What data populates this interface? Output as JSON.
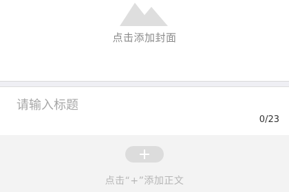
{
  "cover": {
    "icon": "mountain-image-icon",
    "label": "点击添加封面"
  },
  "title": {
    "placeholder": "请输入标题",
    "value": "",
    "counter": "0/23"
  },
  "body": {
    "add_icon": "plus-icon",
    "add_label": "点击“+”添加正文"
  },
  "colors": {
    "background": "#efeff4",
    "icon_gray": "#dedede",
    "add_button": "#dcdcdc"
  }
}
